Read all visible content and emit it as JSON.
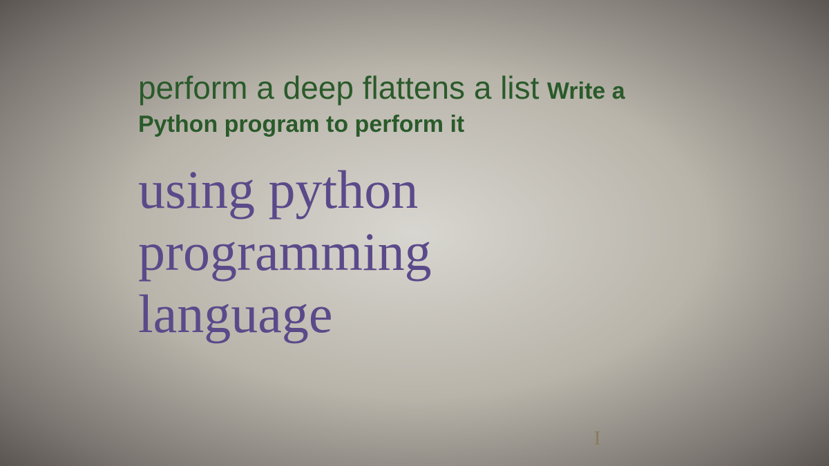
{
  "document": {
    "heading_part1": "perform a deep flattens a list",
    "heading_part2": "Write a",
    "heading_part3": "Python program to perform it",
    "body_line1": "using python",
    "body_line2": "programming",
    "body_line3": "language",
    "cursor_mark": "I"
  }
}
